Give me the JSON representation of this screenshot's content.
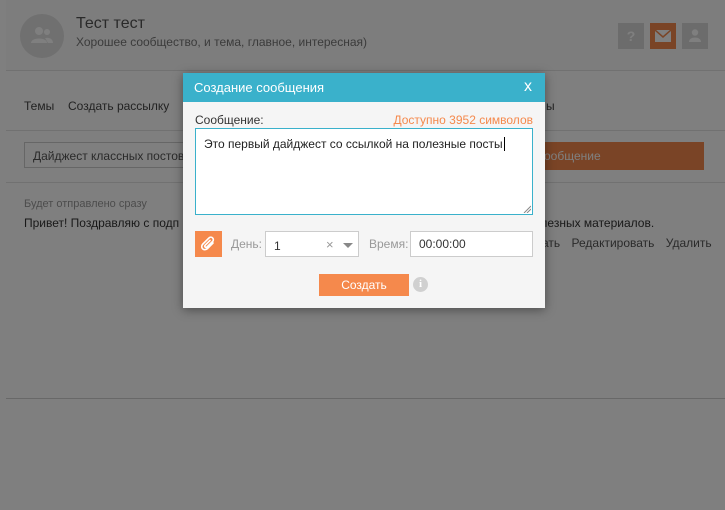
{
  "header": {
    "group_title": "Тест тест",
    "group_subtitle": "Хорошее сообщество, и тема, главное, интересная)",
    "help_icon": "?"
  },
  "nav": {
    "items": [
      "Темы",
      "Создать рассылку",
      "ы"
    ]
  },
  "background": {
    "digest_input_value": "Дайджест классных постов",
    "create_message_button": "ообщение",
    "message_status": "Будет отправлено сразу",
    "message_text_left": "Привет! Поздравляю с подп",
    "message_text_right": "олезных материалов.",
    "actions": [
      "ать",
      "Редактировать",
      "Удалить"
    ]
  },
  "modal": {
    "title": "Создание сообщения",
    "close": "x",
    "message_label": "Сообщение:",
    "counter": "Доступно 3952 символов",
    "message_value": "Это первый дайджест со ссылкой на полезные посты",
    "day_label": "День:",
    "day_value": "1",
    "day_clear": "×",
    "time_label": "Время:",
    "time_value": "00:00:00",
    "create_button": "Создать",
    "info": "i"
  },
  "colors": {
    "accent_orange": "#f5894c",
    "header_blue": "#3ab1cb",
    "overlay": "rgba(0,0,0,0.5)"
  }
}
